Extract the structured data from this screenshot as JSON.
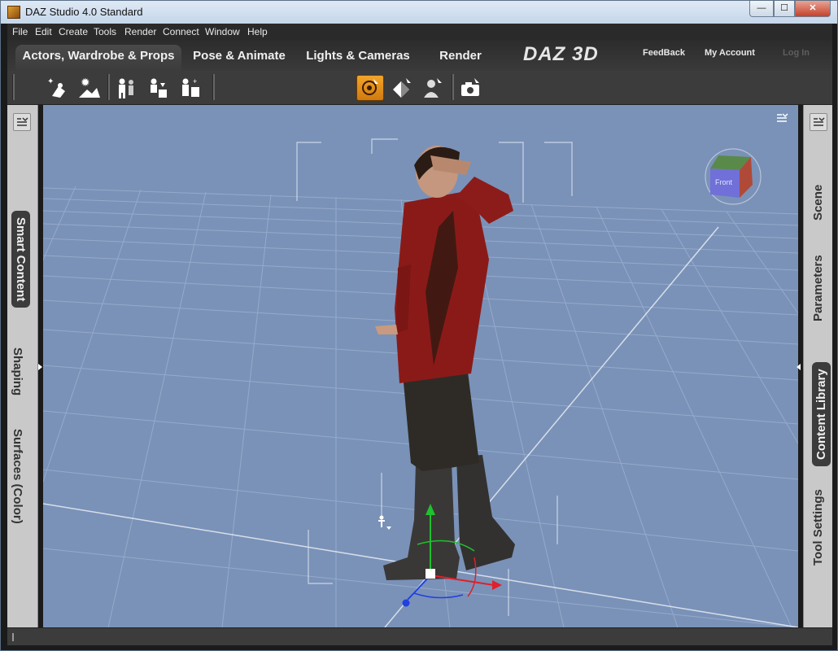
{
  "window": {
    "title": "DAZ Studio 4.0 Standard",
    "min_label": "—",
    "max_label": "☐",
    "close_label": "✕"
  },
  "menu": [
    "File",
    "Edit",
    "Create",
    "Tools",
    "Render",
    "Connect",
    "Window",
    "Help"
  ],
  "tabs": [
    {
      "label": "Actors, Wardrobe & Props",
      "active": true
    },
    {
      "label": "Pose & Animate",
      "active": false
    },
    {
      "label": "Lights & Cameras",
      "active": false
    },
    {
      "label": "Render",
      "active": false
    }
  ],
  "logo": "DAZ 3D",
  "header_links": {
    "feedback": "FeedBack",
    "account": "My Account",
    "login": "Log In"
  },
  "toolbar_icons": [
    "add-item-icon",
    "environment-icon",
    "actor-icon",
    "wardrobe-icon",
    "prop-icon",
    "universal-tool-icon",
    "surface-tool-icon",
    "figure-tool-icon",
    "render-camera-icon"
  ],
  "left_tabs": [
    {
      "label": "Smart Content",
      "active": true
    },
    {
      "label": "Shaping",
      "active": false
    },
    {
      "label": "Surfaces (Color)",
      "active": false
    }
  ],
  "right_tabs": [
    {
      "label": "Scene",
      "active": false
    },
    {
      "label": "Parameters",
      "active": false
    },
    {
      "label": "Content Library",
      "active": true
    },
    {
      "label": "Tool Settings",
      "active": false
    }
  ],
  "viewcube": {
    "face_label": "Front"
  },
  "colors": {
    "viewport_bg": "#7a92b8",
    "tab_active": "#3c3c3c",
    "tool_active": "#f3a528",
    "axis_x": "#e0202a",
    "axis_y": "#20c030",
    "axis_z": "#2040e0"
  }
}
